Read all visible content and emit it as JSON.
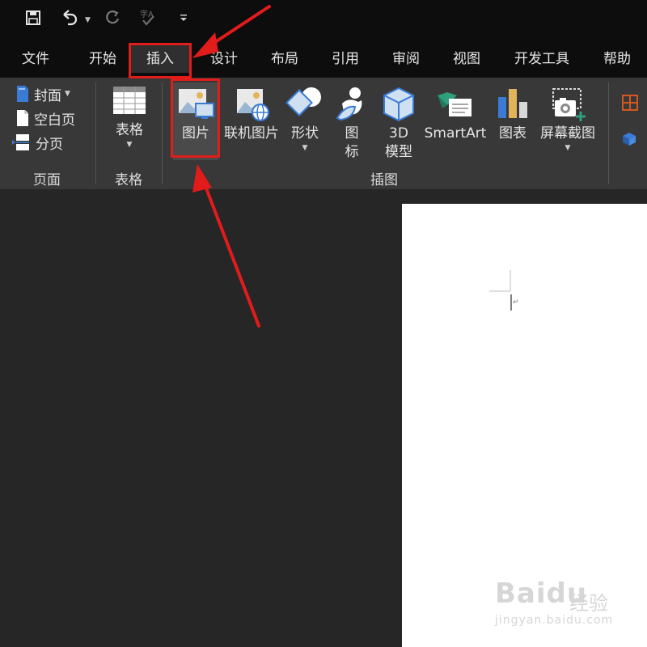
{
  "tabs": [
    {
      "label": "文件"
    },
    {
      "label": "开始"
    },
    {
      "label": "插入"
    },
    {
      "label": "设计"
    },
    {
      "label": "布局"
    },
    {
      "label": "引用"
    },
    {
      "label": "审阅"
    },
    {
      "label": "视图"
    },
    {
      "label": "开发工具"
    },
    {
      "label": "帮助"
    }
  ],
  "active_tab": "插入",
  "ribbon": {
    "pages": {
      "group_label": "页面",
      "cover": "封面",
      "blank_page": "空白页",
      "page_break": "分页"
    },
    "tables": {
      "group_label": "表格",
      "table": "表格"
    },
    "illustrations": {
      "group_label": "插图",
      "picture": "图片",
      "online_picture": "联机图片",
      "shapes": "形状",
      "icons_line1": "图",
      "icons_line2": "标",
      "model3d_line1": "3D",
      "model3d_line2": "模型",
      "smartart": "SmartArt",
      "chart": "图表",
      "screenshot": "屏幕截图"
    }
  },
  "watermark": {
    "brand": "Bai",
    "brand_suffix": "du",
    "cn": "经验",
    "url": "jingyan.baidu.com"
  },
  "colors": {
    "highlight": "#e21b1b",
    "background": "#262626",
    "ribbon": "#383838",
    "titlebar": "#0d0d0d",
    "page": "#ffffff"
  }
}
